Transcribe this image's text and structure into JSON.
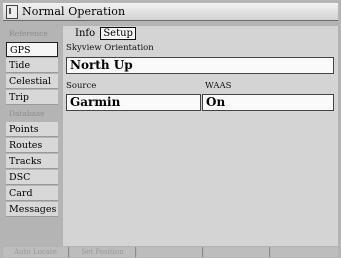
{
  "title_bar": {
    "title": "Normal Operation",
    "icon": "page-icon"
  },
  "sidebar": {
    "items": [
      {
        "label": "Reference",
        "type": "section"
      },
      {
        "label": "GPS",
        "type": "item",
        "selected": true
      },
      {
        "label": "Tide",
        "type": "item"
      },
      {
        "label": "Celestial",
        "type": "item"
      },
      {
        "label": "Trip",
        "type": "item"
      },
      {
        "label": "Database",
        "type": "section"
      },
      {
        "label": "Points",
        "type": "item"
      },
      {
        "label": "Routes",
        "type": "item"
      },
      {
        "label": "Tracks",
        "type": "item"
      },
      {
        "label": "DSC",
        "type": "item"
      },
      {
        "label": "Card",
        "type": "item"
      },
      {
        "label": "Messages",
        "type": "item"
      }
    ]
  },
  "main": {
    "tabs": [
      {
        "label": "Info",
        "active": false
      },
      {
        "label": "Setup",
        "active": true
      }
    ],
    "skyview_label": "Skyview Orientation",
    "skyview_value": "North Up",
    "source_label": "Source",
    "source_value": "Garmin",
    "waas_label": "WAAS",
    "waas_value": "On"
  },
  "softkeys": [
    "Auto Locate",
    "Set Position",
    "",
    "",
    ""
  ]
}
